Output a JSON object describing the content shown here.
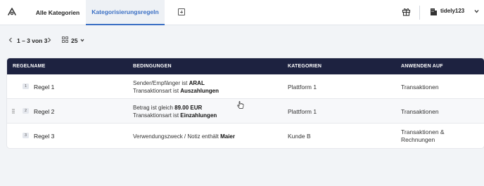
{
  "topbar": {
    "logo_icon": "logo-icon",
    "tabs": [
      {
        "label": "Alle Kategorien",
        "active": false
      },
      {
        "label": "Kategorisierungsregeln",
        "active": true
      }
    ],
    "add_tab_icon": "add-tab-icon",
    "gift_icon": "gift-icon",
    "account": {
      "icon": "building-icon",
      "name": "tidely123"
    }
  },
  "pagination": {
    "range": "1 – 3 von 3",
    "per_page": "25"
  },
  "table": {
    "headers": [
      "REGELNAME",
      "BEDINGUNGEN",
      "KATEGORIEN",
      "ANWENDEN AUF"
    ],
    "rows": [
      {
        "num": "1",
        "name": "Regel 1",
        "cond_l1_pre": "Sender/Empfänger ist ",
        "cond_l1_bold": "ARAL",
        "cond_l2_pre": "Transaktionsart ist ",
        "cond_l2_bold": "Auszahlungen",
        "category": "Plattform 1",
        "apply_l1": "Transaktionen",
        "apply_l2": ""
      },
      {
        "num": "2",
        "name": "Regel 2",
        "cond_l1_pre": "Betrag ist gleich ",
        "cond_l1_bold": "89.00 EUR",
        "cond_l2_pre": "Transaktionsart ist ",
        "cond_l2_bold": "Einzahlungen",
        "category": "Plattform 1",
        "apply_l1": "Transaktionen",
        "apply_l2": ""
      },
      {
        "num": "3",
        "name": "Regel 3",
        "cond_l1_pre": "Verwendungszweck / Notiz enthält ",
        "cond_l1_bold": "Maier",
        "cond_l2_pre": "",
        "cond_l2_bold": "",
        "category": "Kunde B",
        "apply_l1": "Transaktionen &",
        "apply_l2": "Rechnungen"
      }
    ]
  },
  "colors": {
    "accent": "#3a6fc4",
    "header_bg": "#1d2240",
    "page_bg": "#f2f4f7"
  }
}
